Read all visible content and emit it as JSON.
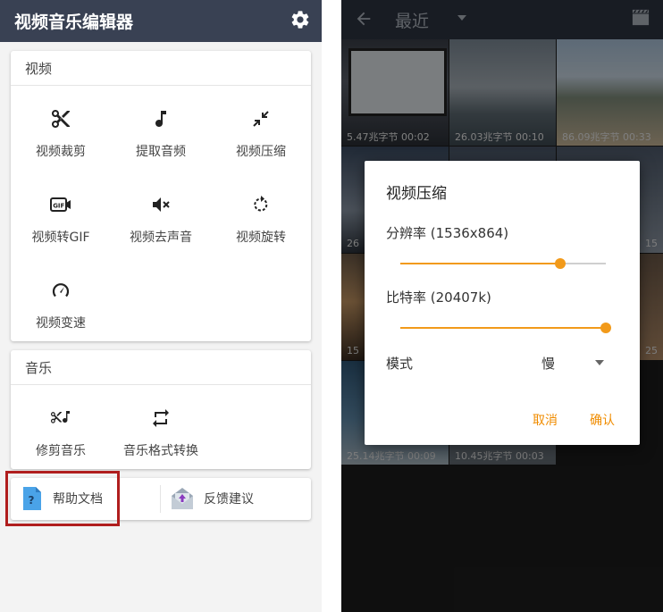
{
  "left": {
    "app_title": "视频音乐编辑器",
    "video_section": {
      "title": "视频",
      "items": [
        {
          "label": "视频裁剪",
          "icon": "scissors-icon"
        },
        {
          "label": "提取音频",
          "icon": "music-note-icon"
        },
        {
          "label": "视频压缩",
          "icon": "compress-arrows-icon"
        },
        {
          "label": "视频转GIF",
          "icon": "gif-icon"
        },
        {
          "label": "视频去声音",
          "icon": "mute-speaker-icon"
        },
        {
          "label": "视频旋转",
          "icon": "rotate-icon"
        },
        {
          "label": "视频变速",
          "icon": "speedometer-icon"
        }
      ]
    },
    "music_section": {
      "title": "音乐",
      "items": [
        {
          "label": "修剪音乐",
          "icon": "scissors-music-icon"
        },
        {
          "label": "音乐格式转换",
          "icon": "repeat-icon"
        }
      ]
    },
    "bottom": {
      "help_label": "帮助文档",
      "feedback_label": "反馈建议"
    },
    "highlight_color": "#b01e1e"
  },
  "right": {
    "topbar_title": "最近",
    "thumbnails": [
      {
        "caption": "5.47兆字节 00:02"
      },
      {
        "caption": "26.03兆字节 00:10"
      },
      {
        "caption": "86.09兆字节 00:33"
      },
      {
        "caption": "26"
      },
      {
        "caption": "15"
      },
      {
        "caption": "15"
      },
      {
        "caption": "25"
      },
      {
        "caption": "25.14兆字节 00:09"
      },
      {
        "caption": "10.45兆字节 00:03"
      }
    ],
    "dialog": {
      "title": "视频压缩",
      "resolution_label": "分辨率 (1536x864)",
      "resolution_value": 0.78,
      "bitrate_label": "比特率 (20407k)",
      "bitrate_value": 1.0,
      "mode_label": "模式",
      "mode_value": "慢",
      "cancel": "取消",
      "confirm": "确认"
    },
    "accent_color": "#f29a1a"
  }
}
